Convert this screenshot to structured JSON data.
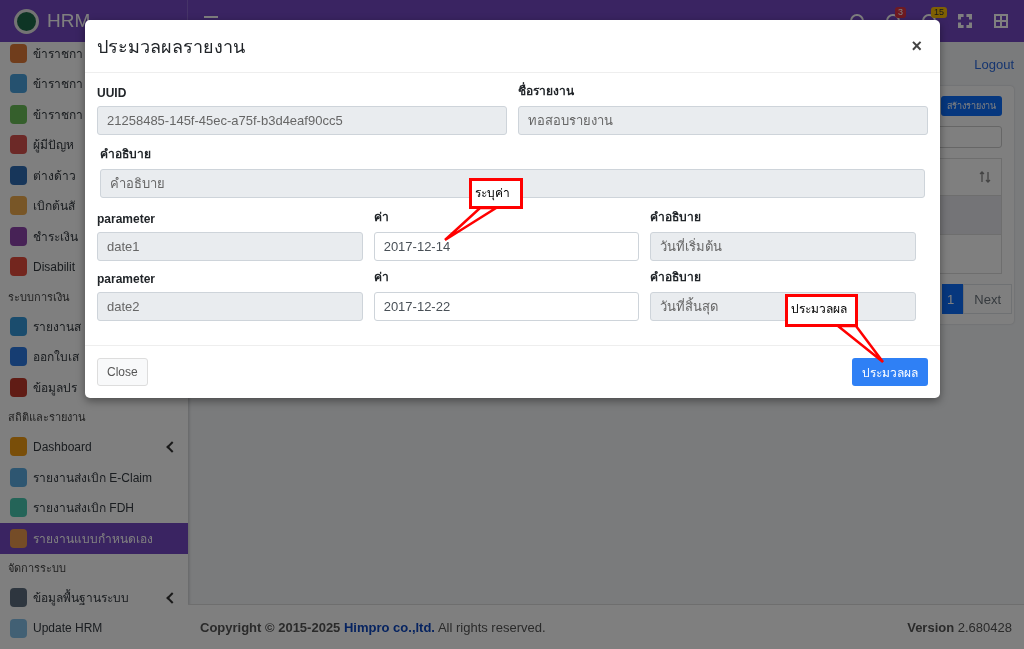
{
  "header": {
    "brand": "HRM",
    "badges": [
      {
        "kind": "chat",
        "count": "3"
      },
      {
        "kind": "bell",
        "count": "15"
      }
    ]
  },
  "sidebar": {
    "sections": [
      {
        "items": [
          {
            "label": "ข้าราชกา",
            "selected": false,
            "has_submenu": false
          },
          {
            "label": "ข้าราชกา",
            "selected": false,
            "has_submenu": false
          },
          {
            "label": "ข้าราชกา",
            "selected": false,
            "has_submenu": false
          },
          {
            "label": "ผู้มีปัญห",
            "selected": false,
            "has_submenu": false
          },
          {
            "label": "ต่างด้าว",
            "selected": false,
            "has_submenu": false
          },
          {
            "label": "เบิกต้นสั",
            "selected": false,
            "has_submenu": false
          },
          {
            "label": "ชำระเงิน",
            "selected": false,
            "has_submenu": false
          },
          {
            "label": "Disabilit",
            "selected": false,
            "has_submenu": false
          }
        ]
      },
      {
        "title": "ระบบการเงิน",
        "items": [
          {
            "label": "รายงานส",
            "selected": false,
            "has_submenu": false
          },
          {
            "label": "ออกใบเส",
            "selected": false,
            "has_submenu": false
          },
          {
            "label": "ข้อมูลปร",
            "selected": false,
            "has_submenu": false
          }
        ]
      },
      {
        "title": "สถิติและรายงาน",
        "items": [
          {
            "label": "Dashboard",
            "selected": false,
            "has_submenu": true
          },
          {
            "label": "รายงานส่งเบิก E-Claim",
            "selected": false,
            "has_submenu": false
          },
          {
            "label": "รายงานส่งเบิก FDH",
            "selected": false,
            "has_submenu": false
          },
          {
            "label": "รายงานแบบกำหนดเอง",
            "selected": true,
            "has_submenu": false
          }
        ]
      },
      {
        "title": "จัดการระบบ",
        "items": [
          {
            "label": "ข้อมูลพื้นฐานระบบ",
            "selected": false,
            "has_submenu": true
          },
          {
            "label": "Update HRM",
            "selected": false,
            "has_submenu": false
          }
        ]
      }
    ]
  },
  "page": {
    "logout": "Logout",
    "create_button": "สร้างรายงาน",
    "pagination": [
      {
        "label": "1",
        "selected": true
      },
      {
        "label": "Next",
        "selected": false
      }
    ]
  },
  "modal": {
    "title": "ประมวลผลรายงาน",
    "close_icon": "×",
    "fields": [
      {
        "label": "UUID",
        "value": "21258485-145f-45ec-a75f-b3d4eaf90cc5",
        "readonly": true
      },
      {
        "label": "ชื่อรายงาน",
        "value": "ทอสอบรายงาน",
        "readonly": true
      },
      {
        "label": "คำอธิบาย",
        "placeholder": "คำอธิบาย",
        "readonly": true
      }
    ],
    "parameters": [
      {
        "name_label": "parameter",
        "name": "date1",
        "value_label": "ค่า",
        "value": "2017-12-14",
        "description_label": "คำอธิบาย",
        "description": "วันที่เริ่มต้น"
      },
      {
        "name_label": "parameter",
        "name": "date2",
        "value_label": "ค่า",
        "value": "2017-12-22",
        "description_label": "คำอธิบาย",
        "description": "วันที่สิ้นสุด"
      }
    ],
    "close_button": "Close",
    "submit_button": "ประมวลผล"
  },
  "annotations": [
    {
      "text": "ระบุค่า"
    },
    {
      "text": "ประมวลผล"
    }
  ],
  "footer": {
    "copyright": "Copyright © 2015-2025",
    "company": "Himpro co.,ltd.",
    "rights": "All rights reserved.",
    "version": "**Version** 2.680428"
  }
}
